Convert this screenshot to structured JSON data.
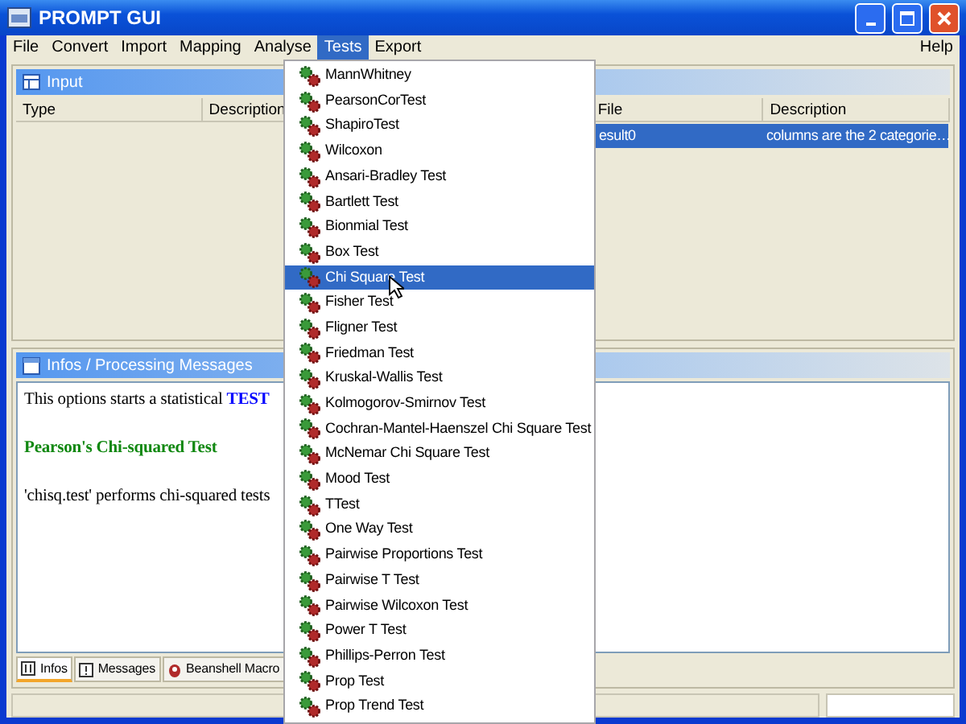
{
  "window": {
    "title": "PROMPT GUI"
  },
  "menu_bar": {
    "items": [
      {
        "label": "File",
        "selected": false
      },
      {
        "label": "Convert",
        "selected": false
      },
      {
        "label": "Import",
        "selected": false
      },
      {
        "label": "Mapping",
        "selected": false
      },
      {
        "label": "Analyse",
        "selected": false
      },
      {
        "label": "Tests",
        "selected": true
      },
      {
        "label": "Export",
        "selected": false
      }
    ],
    "help": "Help"
  },
  "input_panel": {
    "title": "Input",
    "left_columns": [
      "Type",
      "Description"
    ],
    "right_columns": [
      "File",
      "Description"
    ],
    "rows": [
      {
        "cells": [
          "esult0",
          "columns are the 2 categorie…"
        ],
        "selected": true
      }
    ]
  },
  "info_panel": {
    "title": "Infos / Processing Messages",
    "lines": [
      {
        "kind": "plain",
        "text": "This options starts a statistical **TEST**"
      },
      {
        "kind": "heading",
        "text": "Pearson's Chi-squared Test"
      },
      {
        "kind": "plain",
        "text": "'chisq.test' performs chi-squared tests"
      }
    ],
    "tabs": [
      {
        "label": "Infos",
        "selected": true
      },
      {
        "label": "Messages",
        "selected": false
      },
      {
        "label": "Beanshell Macro",
        "selected": false
      }
    ]
  },
  "tests_menu": [
    {
      "label": "MannWhitney",
      "selected": false
    },
    {
      "label": "PearsonCorTest",
      "selected": false
    },
    {
      "label": "ShapiroTest",
      "selected": false
    },
    {
      "label": "Wilcoxon",
      "selected": false
    },
    {
      "label": "Ansari-Bradley Test",
      "selected": false
    },
    {
      "label": "Bartlett Test",
      "selected": false
    },
    {
      "label": "Bionmial Test",
      "selected": false
    },
    {
      "label": "Box Test",
      "selected": false
    },
    {
      "label": "Chi Square Test",
      "selected": true
    },
    {
      "label": "Fisher Test",
      "selected": false
    },
    {
      "label": "Fligner Test",
      "selected": false
    },
    {
      "label": "Friedman Test",
      "selected": false
    },
    {
      "label": "Kruskal-Wallis Test",
      "selected": false
    },
    {
      "label": "Kolmogorov-Smirnov Test",
      "selected": false
    },
    {
      "label": "Cochran-Mantel-Haenszel Chi Square Test",
      "selected": false
    },
    {
      "label": "McNemar Chi Square Test",
      "selected": false
    },
    {
      "label": "Mood Test",
      "selected": false
    },
    {
      "label": "TTest",
      "selected": false
    },
    {
      "label": "One Way Test",
      "selected": false
    },
    {
      "label": "Pairwise Proportions Test",
      "selected": false
    },
    {
      "label": "Pairwise T Test",
      "selected": false
    },
    {
      "label": "Pairwise Wilcoxon Test",
      "selected": false
    },
    {
      "label": "Power T Test",
      "selected": false
    },
    {
      "label": "Phillips-Perron Test",
      "selected": false
    },
    {
      "label": "Prop Test",
      "selected": false
    },
    {
      "label": "Prop Trend Test",
      "selected": false
    }
  ]
}
